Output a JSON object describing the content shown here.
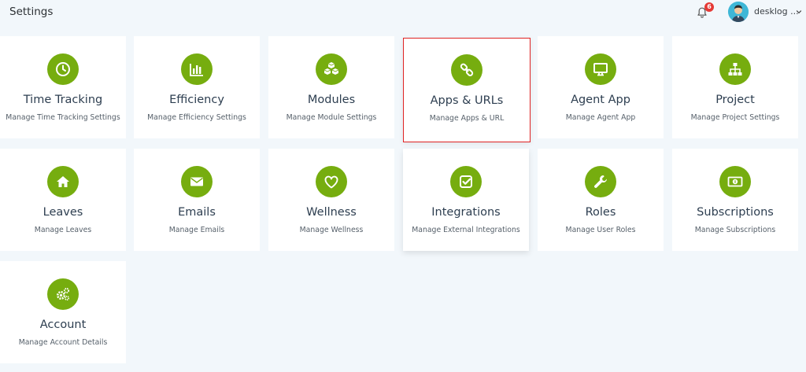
{
  "header": {
    "title": "Settings",
    "notification_count": "6",
    "user_name": "desklog ..."
  },
  "colors": {
    "accent": "#76ad0f",
    "badge": "#e53935",
    "highlight_border": "#e02424",
    "background": "#f2f7fb"
  },
  "cards": [
    {
      "title": "Time Tracking",
      "subtitle": "Manage Time Tracking Settings",
      "icon": "clock-icon"
    },
    {
      "title": "Efficiency",
      "subtitle": "Manage Efficiency Settings",
      "icon": "bar-chart-icon"
    },
    {
      "title": "Modules",
      "subtitle": "Manage Module Settings",
      "icon": "cubes-icon"
    },
    {
      "title": "Apps & URLs",
      "subtitle": "Manage Apps & URL",
      "icon": "link-icon",
      "selected": true
    },
    {
      "title": "Agent App",
      "subtitle": "Manage Agent App",
      "icon": "monitor-icon"
    },
    {
      "title": "Project",
      "subtitle": "Manage Project Settings",
      "icon": "sitemap-icon"
    },
    {
      "title": "Leaves",
      "subtitle": "Manage Leaves",
      "icon": "home-icon"
    },
    {
      "title": "Emails",
      "subtitle": "Manage Emails",
      "icon": "envelope-icon"
    },
    {
      "title": "Wellness",
      "subtitle": "Manage Wellness",
      "icon": "heart-icon"
    },
    {
      "title": "Integrations",
      "subtitle": "Manage External Integrations",
      "icon": "check-square-icon"
    },
    {
      "title": "Roles",
      "subtitle": "Manage User Roles",
      "icon": "wrench-icon"
    },
    {
      "title": "Subscriptions",
      "subtitle": "Manage Subscriptions",
      "icon": "money-icon"
    },
    {
      "title": "Account",
      "subtitle": "Manage Account Details",
      "icon": "cogs-icon"
    }
  ]
}
